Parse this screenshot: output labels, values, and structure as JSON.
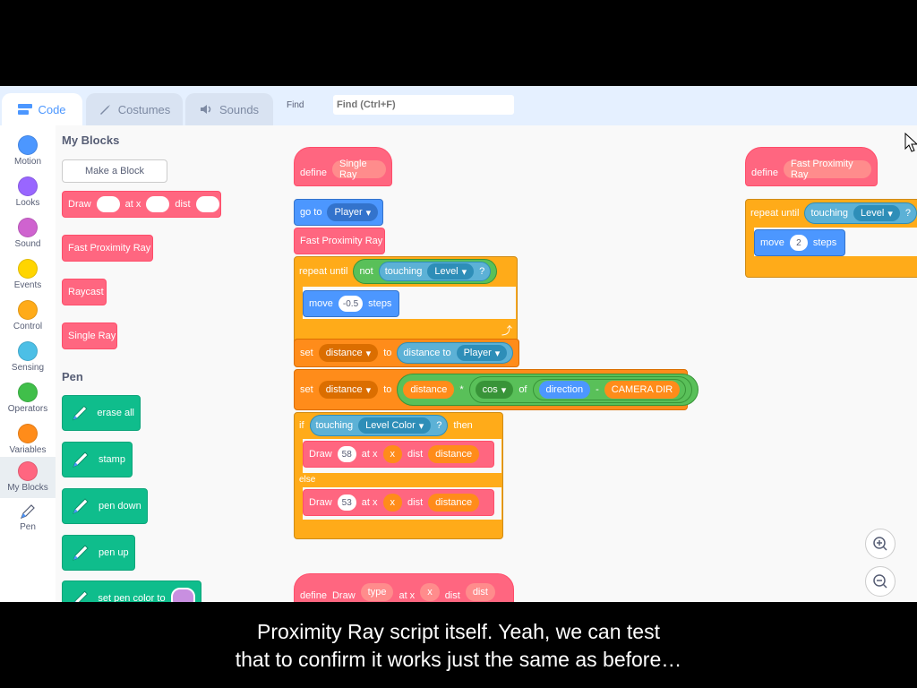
{
  "tabs": [
    {
      "label": "Code",
      "icon": "code-icon",
      "active": true
    },
    {
      "label": "Costumes",
      "icon": "brush-icon",
      "active": false
    },
    {
      "label": "Sounds",
      "icon": "speaker-icon",
      "active": false
    }
  ],
  "find": {
    "label": "Find",
    "placeholder": "Find (Ctrl+F)"
  },
  "categories": [
    {
      "label": "Motion",
      "color": "#4c97ff"
    },
    {
      "label": "Looks",
      "color": "#9966ff"
    },
    {
      "label": "Sound",
      "color": "#cf63cf"
    },
    {
      "label": "Events",
      "color": "#ffd500"
    },
    {
      "label": "Control",
      "color": "#ffab19"
    },
    {
      "label": "Sensing",
      "color": "#4cbfe6"
    },
    {
      "label": "Operators",
      "color": "#40bf4a"
    },
    {
      "label": "Variables",
      "color": "#ff8c1a"
    },
    {
      "label": "My Blocks",
      "color": "#ff6680"
    },
    {
      "label": "Pen",
      "color": "#0fbd8c"
    }
  ],
  "palette": {
    "my_blocks_title": "My Blocks",
    "make_block": "Make a Block",
    "draw_block": {
      "w1": "Draw",
      "w2": "at x",
      "w3": "dist"
    },
    "fast_proximity": "Fast Proximity Ray",
    "raycast": "Raycast",
    "single_ray": "Single Ray",
    "pen_title": "Pen",
    "pen_blocks": [
      "erase all",
      "stamp",
      "pen down",
      "pen up",
      "set pen color to"
    ]
  },
  "script1": {
    "define": "define",
    "name": "Single Ray",
    "goto": "go to",
    "goto_target": "Player",
    "call_fast": "Fast Proximity Ray",
    "repeat_until": "repeat until",
    "not": "not",
    "touching": "touching",
    "level": "Level",
    "q": "?",
    "move": "move",
    "move_val": "-0.5",
    "steps": "steps",
    "set": "set",
    "var_distance": "distance",
    "to": "to",
    "distance_to": "distance to",
    "player": "Player",
    "distance_val": "distance",
    "times": "*",
    "cos": "cos",
    "of": "of",
    "direction": "direction",
    "minus": "-",
    "camera_dir": "CAMERA DIR",
    "if": "if",
    "level_color": "Level Color",
    "then": "then",
    "draw": "Draw",
    "draw_val1": "58",
    "at_x": "at x",
    "x": "x",
    "dist": "dist",
    "else": "else",
    "draw_val2": "53"
  },
  "script2": {
    "define": "define",
    "name": "Fast Proximity Ray",
    "repeat_until": "repeat until",
    "touching": "touching",
    "level": "Level",
    "q": "?",
    "move": "move",
    "move_val": "2",
    "steps": "steps"
  },
  "script3": {
    "define": "define",
    "draw": "Draw",
    "type": "type",
    "at_x": "at x",
    "x": "x",
    "dist": "dist",
    "dist2": "dist"
  },
  "subtitle": {
    "line1": "Proximity Ray script itself. Yeah, we can test",
    "line2": "that to confirm it works just the same as before…"
  }
}
